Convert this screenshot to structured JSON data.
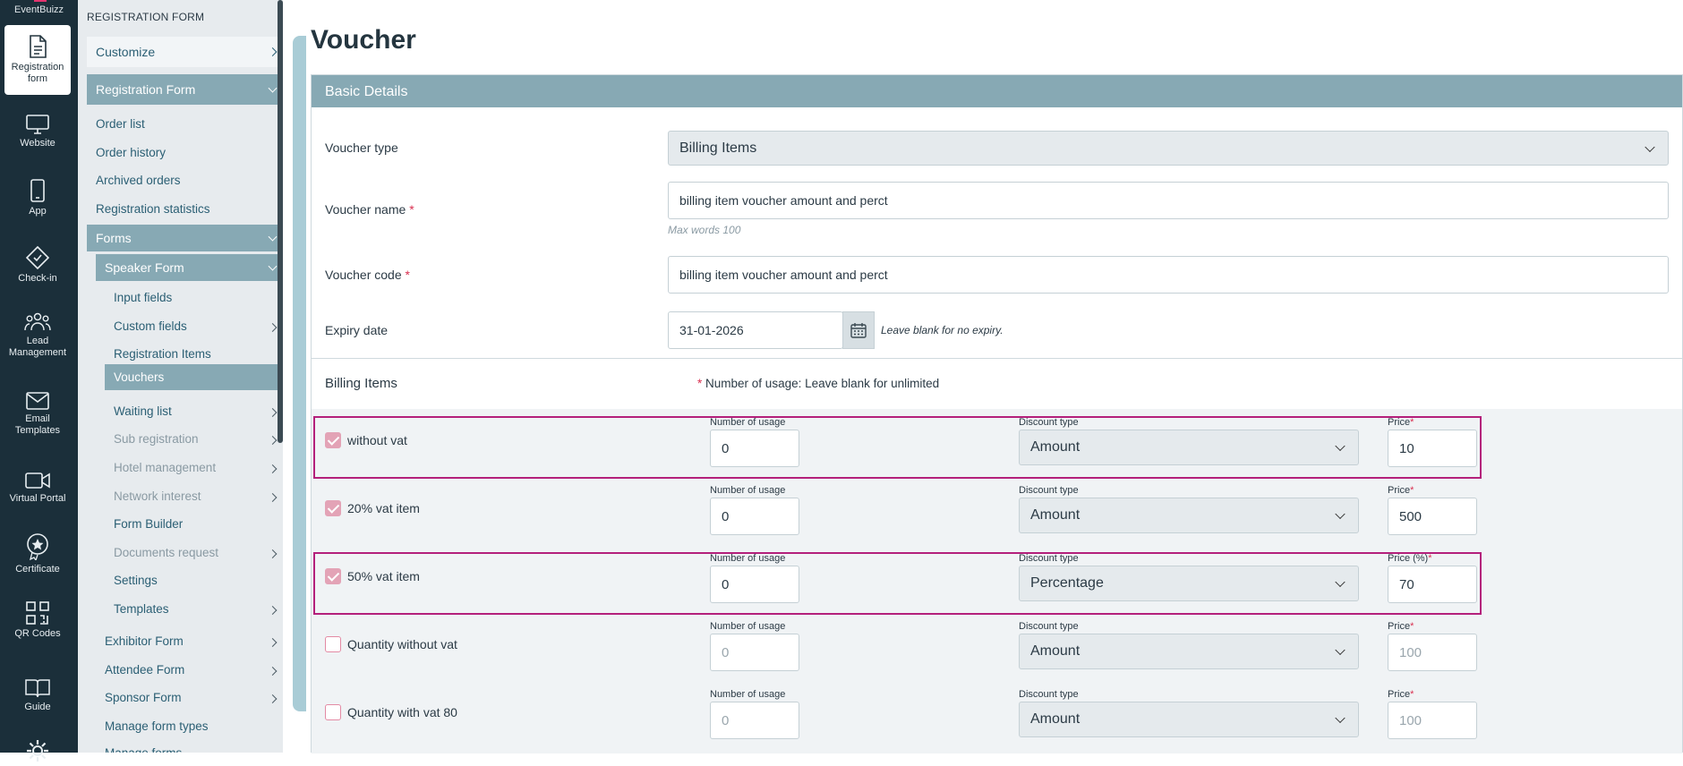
{
  "rail": {
    "brand": "EventBuizz",
    "items": [
      {
        "label": "Registration form",
        "icon": "document-icon"
      },
      {
        "label": "Website",
        "icon": "monitor-icon"
      },
      {
        "label": "App",
        "icon": "phone-icon"
      },
      {
        "label": "Check-in",
        "icon": "ticket-icon"
      },
      {
        "label": "Lead Management",
        "icon": "people-icon"
      },
      {
        "label": "Email Templates",
        "icon": "mail-icon"
      },
      {
        "label": "Virtual Portal",
        "icon": "video-icon"
      },
      {
        "label": "Certificate",
        "icon": "badge-icon"
      },
      {
        "label": "QR Codes",
        "icon": "qr-icon"
      },
      {
        "label": "Guide",
        "icon": "book-icon"
      }
    ]
  },
  "sidebar": {
    "header": "REGISTRATION FORM",
    "customize": "Customize",
    "registration_form": "Registration Form",
    "reg_items": [
      "Order list",
      "Order history",
      "Archived orders",
      "Registration statistics"
    ],
    "forms": "Forms",
    "speaker_form": "Speaker Form",
    "speaker_items": [
      {
        "label": "Input fields",
        "chev": false,
        "dim": false,
        "active": false
      },
      {
        "label": "Custom fields",
        "chev": true,
        "dim": false,
        "active": false
      },
      {
        "label": "Registration Items",
        "chev": false,
        "dim": false,
        "active": false
      },
      {
        "label": "Vouchers",
        "chev": false,
        "dim": false,
        "active": true
      },
      {
        "label": "Waiting list",
        "chev": true,
        "dim": false,
        "active": false
      },
      {
        "label": "Sub registration",
        "chev": true,
        "dim": true,
        "active": false
      },
      {
        "label": "Hotel management",
        "chev": true,
        "dim": true,
        "active": false
      },
      {
        "label": "Network interest",
        "chev": true,
        "dim": true,
        "active": false
      },
      {
        "label": "Form Builder",
        "chev": false,
        "dim": false,
        "active": false
      },
      {
        "label": "Documents request",
        "chev": true,
        "dim": true,
        "active": false
      },
      {
        "label": "Settings",
        "chev": false,
        "dim": false,
        "active": false
      },
      {
        "label": "Templates",
        "chev": true,
        "dim": false,
        "active": false
      }
    ],
    "other_forms": [
      {
        "label": "Exhibitor Form",
        "chev": true
      },
      {
        "label": "Attendee Form",
        "chev": true
      },
      {
        "label": "Sponsor Form",
        "chev": true
      },
      {
        "label": "Manage form types",
        "chev": false
      },
      {
        "label": "Manage forms",
        "chev": false
      }
    ]
  },
  "page": {
    "title": "Voucher",
    "panel_title": "Basic Details",
    "voucher_type_label": "Voucher type",
    "voucher_type_value": "Billing Items",
    "voucher_name_label": "Voucher name",
    "voucher_name_value": "billing item voucher amount and perct",
    "voucher_name_hint": "Max words 100",
    "voucher_code_label": "Voucher code",
    "voucher_code_value": "billing item voucher amount and perct",
    "expiry_label": "Expiry date",
    "expiry_value": "31-01-2026",
    "expiry_hint": "Leave blank for no expiry.",
    "billing_title": "Billing Items",
    "billing_note": "Number of usage: Leave blank for unlimited",
    "required_mark": "*"
  },
  "billing": {
    "usage_label": "Number of usage",
    "discount_label": "Discount type",
    "rows": [
      {
        "name": "without vat",
        "checked": true,
        "usage": "0",
        "discount": "Amount",
        "price_label": "Price",
        "price": "10",
        "highlight": true
      },
      {
        "name": "20% vat item",
        "checked": true,
        "usage": "0",
        "discount": "Amount",
        "price_label": "Price",
        "price": "500",
        "highlight": false
      },
      {
        "name": "50% vat item",
        "checked": true,
        "usage": "0",
        "discount": "Percentage",
        "price_label": "Price (%)",
        "price": "70",
        "highlight": true
      },
      {
        "name": "Quantity without vat",
        "checked": false,
        "usage": "0",
        "discount": "Amount",
        "price_label": "Price",
        "price": "100",
        "highlight": false
      },
      {
        "name": "Quantity with vat 80",
        "checked": false,
        "usage": "0",
        "discount": "Amount",
        "price_label": "Price",
        "price": "100",
        "highlight": false
      }
    ]
  },
  "colors": {
    "highlight_border": "#b4207b",
    "accent": "#87a9b4",
    "rail": "#1b2f3a"
  }
}
